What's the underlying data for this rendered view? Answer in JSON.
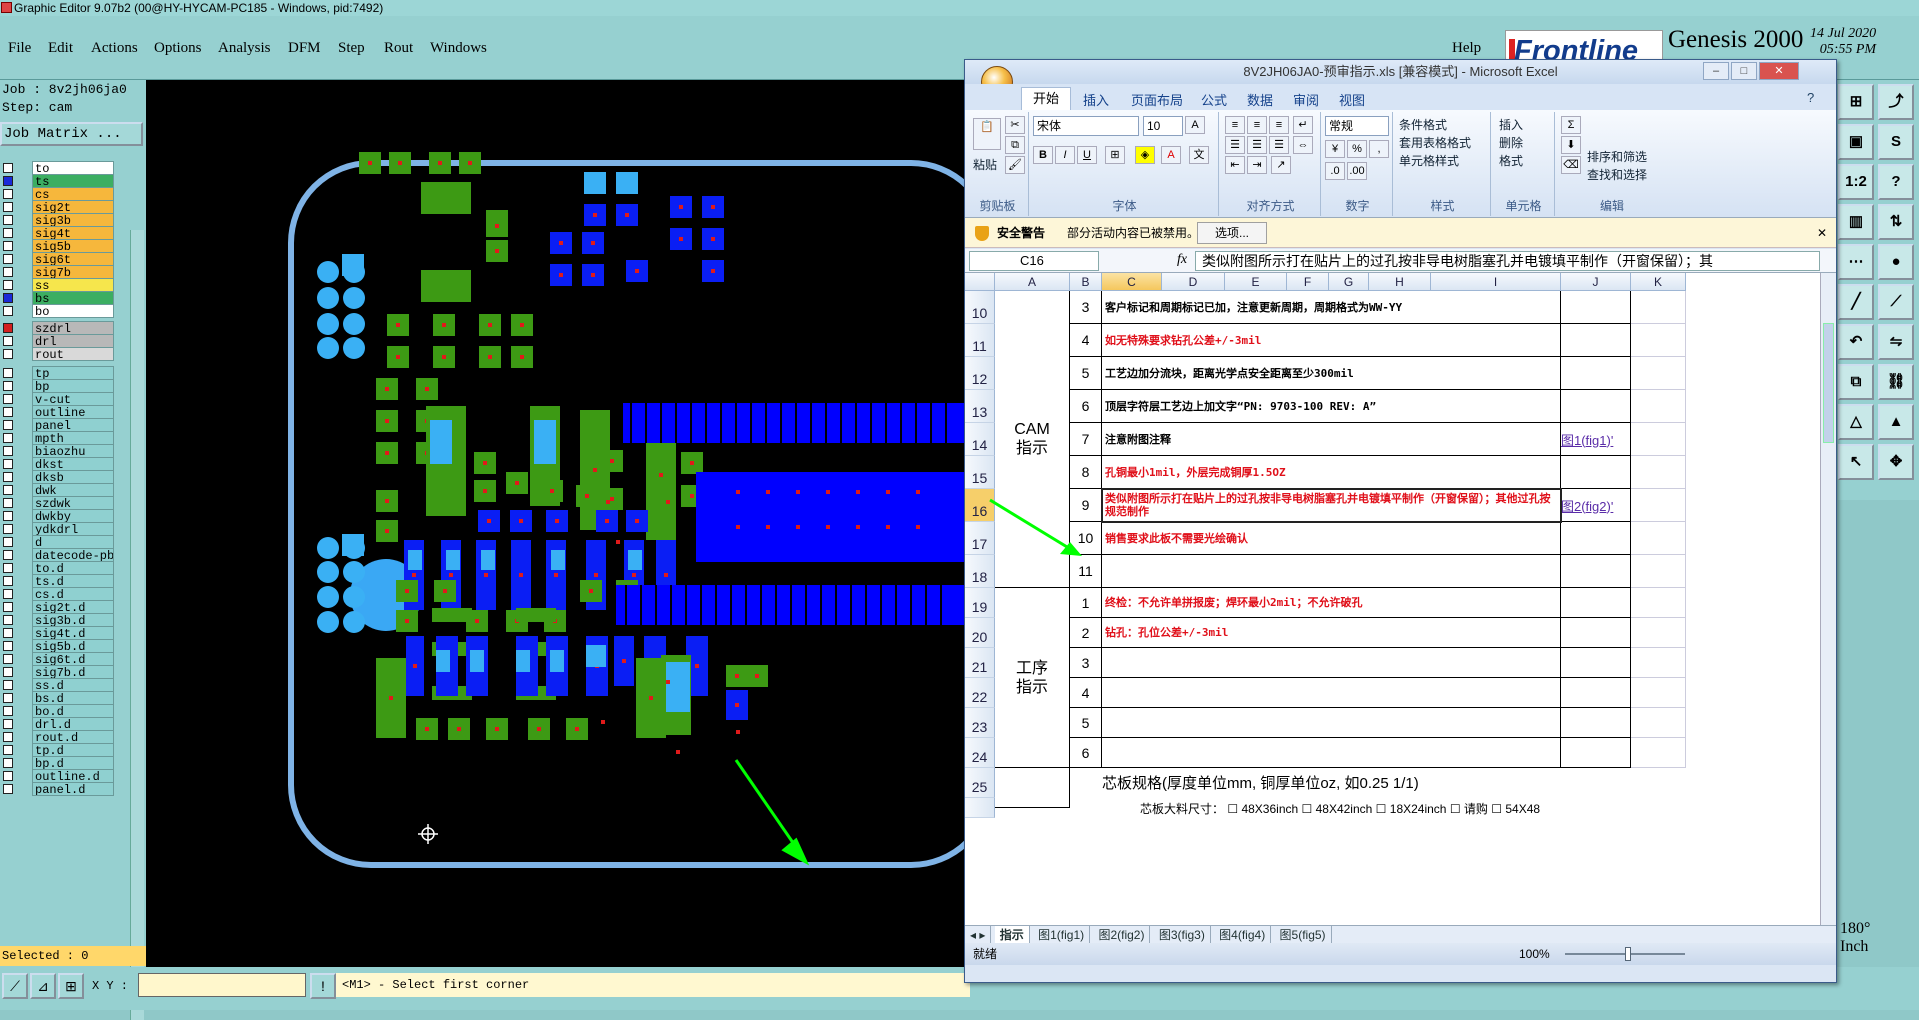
{
  "ge": {
    "title": "Graphic Editor 9.07b2 (00@HY-HYCAM-PC185 - Windows, pid:7492)",
    "menus": [
      "File",
      "Edit",
      "Actions",
      "Options",
      "Analysis",
      "DFM",
      "Step",
      "Rout",
      "Windows"
    ],
    "help": "Help",
    "brand": "Frontline",
    "product": "Genesis 2000",
    "date": "14 Jul 2020",
    "time": "05:55 PM",
    "job": "Job : 8v2jh06ja0",
    "step": "Step: cam",
    "job_matrix": "Job Matrix ...",
    "layers": [
      {
        "name": "to",
        "color": "#ffffff",
        "mark": ""
      },
      {
        "name": "ts",
        "color": "#3cae62",
        "mark": "#1a2ad8"
      },
      {
        "name": "cs",
        "color": "#f6b73c",
        "mark": ""
      },
      {
        "name": "sig2t",
        "color": "#f6b73c",
        "mark": ""
      },
      {
        "name": "sig3b",
        "color": "#f6b73c",
        "mark": ""
      },
      {
        "name": "sig4t",
        "color": "#f6b73c",
        "mark": ""
      },
      {
        "name": "sig5b",
        "color": "#f6b73c",
        "mark": ""
      },
      {
        "name": "sig6t",
        "color": "#f6b73c",
        "mark": ""
      },
      {
        "name": "sig7b",
        "color": "#f6b73c",
        "mark": ""
      },
      {
        "name": "ss",
        "color": "#f6e64c",
        "mark": ""
      },
      {
        "name": "bs",
        "color": "#3cae62",
        "mark": "#1a2ad8"
      },
      {
        "name": "bo",
        "color": "#ffffff",
        "mark": ""
      },
      {
        "name": "szdrl",
        "color": "#b8b8b8",
        "mark": "#d42020"
      },
      {
        "name": "drl",
        "color": "#b8b8b8",
        "mark": ""
      },
      {
        "name": "rout",
        "color": "#d9d9d9",
        "mark": ""
      },
      {
        "name": "tp",
        "color": "#8fd0d0",
        "mark": ""
      },
      {
        "name": "bp",
        "color": "#8fd0d0",
        "mark": ""
      },
      {
        "name": "v-cut",
        "color": "#8fd0d0",
        "mark": ""
      },
      {
        "name": "outline",
        "color": "#8fd0d0",
        "mark": ""
      },
      {
        "name": "panel",
        "color": "#8fd0d0",
        "mark": ""
      },
      {
        "name": "mpth",
        "color": "#8fd0d0",
        "mark": ""
      },
      {
        "name": "biaozhu",
        "color": "#8fd0d0",
        "mark": ""
      },
      {
        "name": "dkst",
        "color": "#8fd0d0",
        "mark": ""
      },
      {
        "name": "dksb",
        "color": "#8fd0d0",
        "mark": ""
      },
      {
        "name": "dwk",
        "color": "#8fd0d0",
        "mark": ""
      },
      {
        "name": "szdwk",
        "color": "#8fd0d0",
        "mark": ""
      },
      {
        "name": "dwkby",
        "color": "#8fd0d0",
        "mark": ""
      },
      {
        "name": "ydkdrl",
        "color": "#8fd0d0",
        "mark": ""
      },
      {
        "name": "d",
        "color": "#8fd0d0",
        "mark": ""
      },
      {
        "name": "datecode-pbe",
        "color": "#8fd0d0",
        "mark": ""
      },
      {
        "name": "to.d",
        "color": "#8fd0d0",
        "mark": ""
      },
      {
        "name": "ts.d",
        "color": "#8fd0d0",
        "mark": ""
      },
      {
        "name": "cs.d",
        "color": "#8fd0d0",
        "mark": ""
      },
      {
        "name": "sig2t.d",
        "color": "#8fd0d0",
        "mark": ""
      },
      {
        "name": "sig3b.d",
        "color": "#8fd0d0",
        "mark": ""
      },
      {
        "name": "sig4t.d",
        "color": "#8fd0d0",
        "mark": ""
      },
      {
        "name": "sig5b.d",
        "color": "#8fd0d0",
        "mark": ""
      },
      {
        "name": "sig6t.d",
        "color": "#8fd0d0",
        "mark": ""
      },
      {
        "name": "sig7b.d",
        "color": "#8fd0d0",
        "mark": ""
      },
      {
        "name": "ss.d",
        "color": "#8fd0d0",
        "mark": ""
      },
      {
        "name": "bs.d",
        "color": "#8fd0d0",
        "mark": ""
      },
      {
        "name": "bo.d",
        "color": "#8fd0d0",
        "mark": ""
      },
      {
        "name": "drl.d",
        "color": "#8fd0d0",
        "mark": ""
      },
      {
        "name": "rout.d",
        "color": "#8fd0d0",
        "mark": ""
      },
      {
        "name": "tp.d",
        "color": "#8fd0d0",
        "mark": ""
      },
      {
        "name": "bp.d",
        "color": "#8fd0d0",
        "mark": ""
      },
      {
        "name": "outline.d",
        "color": "#8fd0d0",
        "mark": ""
      },
      {
        "name": "panel.d",
        "color": "#8fd0d0",
        "mark": ""
      }
    ],
    "selected": "Selected : 0",
    "xy_label": "X Y :",
    "status_msg": "<M1> - Select first corner",
    "tool_labels": [
      "1:2",
      "?"
    ],
    "unit_angle": "180°",
    "unit": "Inch"
  },
  "excel": {
    "title": "8V2JH06JA0-预审指示.xls [兼容模式] - Microsoft Excel",
    "tabs": [
      "开始",
      "插入",
      "页面布局",
      "公式",
      "数据",
      "审阅",
      "视图"
    ],
    "groups": {
      "clipboard": "剪贴板",
      "font": "字体",
      "align": "对齐方式",
      "number": "数字",
      "style": "样式",
      "cells": "单元格",
      "edit": "编辑"
    },
    "paste": "粘贴",
    "font_name": "宋体",
    "font_size": "10",
    "number_format": "常规",
    "style_items": [
      "条件格式",
      "套用表格格式",
      "单元格样式"
    ],
    "cell_items": [
      "插入",
      "删除",
      "格式"
    ],
    "edit_items": [
      "排序和筛选",
      "查找和选择"
    ],
    "security_title": "安全警告",
    "security_msg": "部分活动内容已被禁用。",
    "security_btn": "选项...",
    "name_box": "C16",
    "formula": "类似附图所示打在贴片上的过孔按非导电树脂塞孔并电镀填平制作（开窗保留）；其",
    "columns": [
      "A",
      "B",
      "C",
      "D",
      "E",
      "F",
      "G",
      "H",
      "I",
      "J",
      "K"
    ],
    "cam_label": "CAM\n指示",
    "proc_label": "工序\n指示",
    "rows": [
      {
        "r": "10",
        "n": "3",
        "t": "客户标记和周期标记已加，注意更新周期，周期格式为WW-YY",
        "red": false,
        "link": ""
      },
      {
        "r": "11",
        "n": "4",
        "t": "如无特殊要求钻孔公差+/-3mil",
        "red": true,
        "link": ""
      },
      {
        "r": "12",
        "n": "5",
        "t": "工艺边加分流块，距离光学点安全距离至少300mil",
        "red": false,
        "link": ""
      },
      {
        "r": "13",
        "n": "6",
        "t": "顶层字符层工艺边上加文字“PN: 9703-100 REV: A”",
        "red": false,
        "link": ""
      },
      {
        "r": "14",
        "n": "7",
        "t": "注意附图注释",
        "red": false,
        "link": "图1(fig1)'"
      },
      {
        "r": "15",
        "n": "8",
        "t": "孔铜最小1mil，外层完成铜厚1.5OZ",
        "red": true,
        "link": ""
      },
      {
        "r": "16",
        "n": "9",
        "t": "类似附图所示打在贴片上的过孔按非导电树脂塞孔并电镀填平制作（开窗保留）；其他过孔按规范制作",
        "red": true,
        "link": "图2(fig2)'"
      },
      {
        "r": "17",
        "n": "10",
        "t": "销售要求此板不需要光绘确认",
        "red": true,
        "link": ""
      },
      {
        "r": "18",
        "n": "11",
        "t": "",
        "red": false,
        "link": ""
      },
      {
        "r": "19",
        "n": "1",
        "t": "终检：不允许单拼报废；焊环最小2mil；不允许破孔",
        "red": true,
        "link": ""
      },
      {
        "r": "20",
        "n": "2",
        "t": "钻孔：孔位公差+/-3mil",
        "red": true,
        "link": ""
      },
      {
        "r": "21",
        "n": "3",
        "t": "",
        "red": false,
        "link": ""
      },
      {
        "r": "22",
        "n": "4",
        "t": "",
        "red": false,
        "link": ""
      },
      {
        "r": "23",
        "n": "5",
        "t": "",
        "red": false,
        "link": ""
      },
      {
        "r": "24",
        "n": "6",
        "t": "",
        "red": false,
        "link": ""
      }
    ],
    "row25": {
      "r": "25",
      "label": "芯板规格(厚度单位mm, 铜厚单位oz, 如0.25 1/1)"
    },
    "row26": {
      "label": "芯板大料尺寸：",
      "opts": [
        "48X36inch",
        "48X42inch",
        "18X24inch",
        "请购",
        "54X48"
      ]
    },
    "sheet_tabs": [
      "指示",
      "图1(fig1)",
      "图2(fig2)",
      "图3(fig3)",
      "图4(fig4)",
      "图5(fig5)"
    ],
    "status_ready": "就绪",
    "zoom": "100%"
  }
}
